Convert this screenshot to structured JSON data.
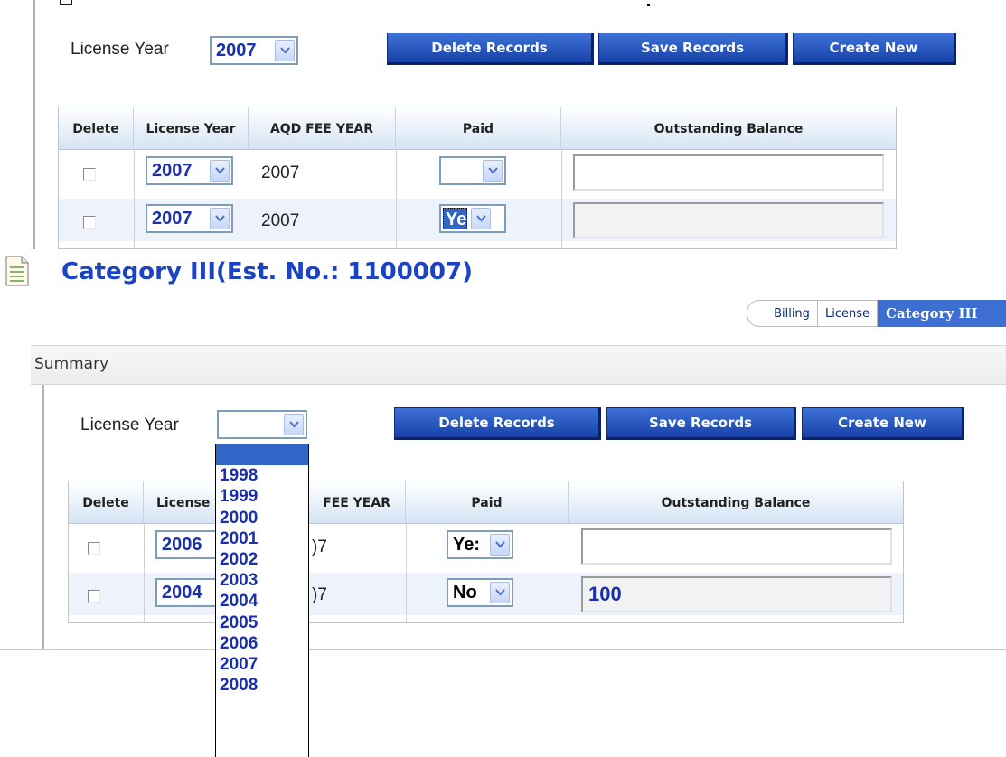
{
  "top_section": {
    "license_year_label": "License Year",
    "license_year_value": "2007",
    "buttons": {
      "delete": "Delete Records",
      "save": "Save Records",
      "create": "Create New"
    },
    "table": {
      "headers": [
        "Delete",
        "License Year",
        "AQD FEE YEAR",
        "Paid",
        "Outstanding Balance"
      ],
      "rows": [
        {
          "license_year": "2007",
          "aqd_fee_year": "2007",
          "paid": "",
          "balance": ""
        },
        {
          "license_year": "2007",
          "aqd_fee_year": "2007",
          "paid": "Ye",
          "balance": ""
        }
      ]
    }
  },
  "category": {
    "title": "Category III(Est. No.: 1100007)"
  },
  "tabs": [
    "Billing",
    "License",
    "Category III"
  ],
  "summary": {
    "title": "Summary",
    "license_year_label": "License Year",
    "license_year_value": "",
    "buttons": {
      "delete": "Delete Records",
      "save": "Save Records",
      "create": "Create New"
    },
    "table": {
      "headers": [
        "Delete",
        "License",
        "FEE YEAR",
        "Paid",
        "Outstanding Balance"
      ],
      "rows": [
        {
          "license_year": "2006",
          "aqd_fee_year": ")7",
          "paid": "Ye:",
          "balance": ""
        },
        {
          "license_year": "2004",
          "aqd_fee_year": ")7",
          "paid": "No",
          "balance": "100"
        }
      ]
    },
    "dropdown_options": [
      "",
      "1998",
      "1999",
      "2000",
      "2001",
      "2002",
      "2003",
      "2004",
      "2005",
      "2006",
      "2007",
      "2008"
    ]
  },
  "colors": {
    "accent": "#1c43c4",
    "button": "#1741a8",
    "tab_active": "#3d6ed1",
    "option_text": "#1a2faa"
  }
}
